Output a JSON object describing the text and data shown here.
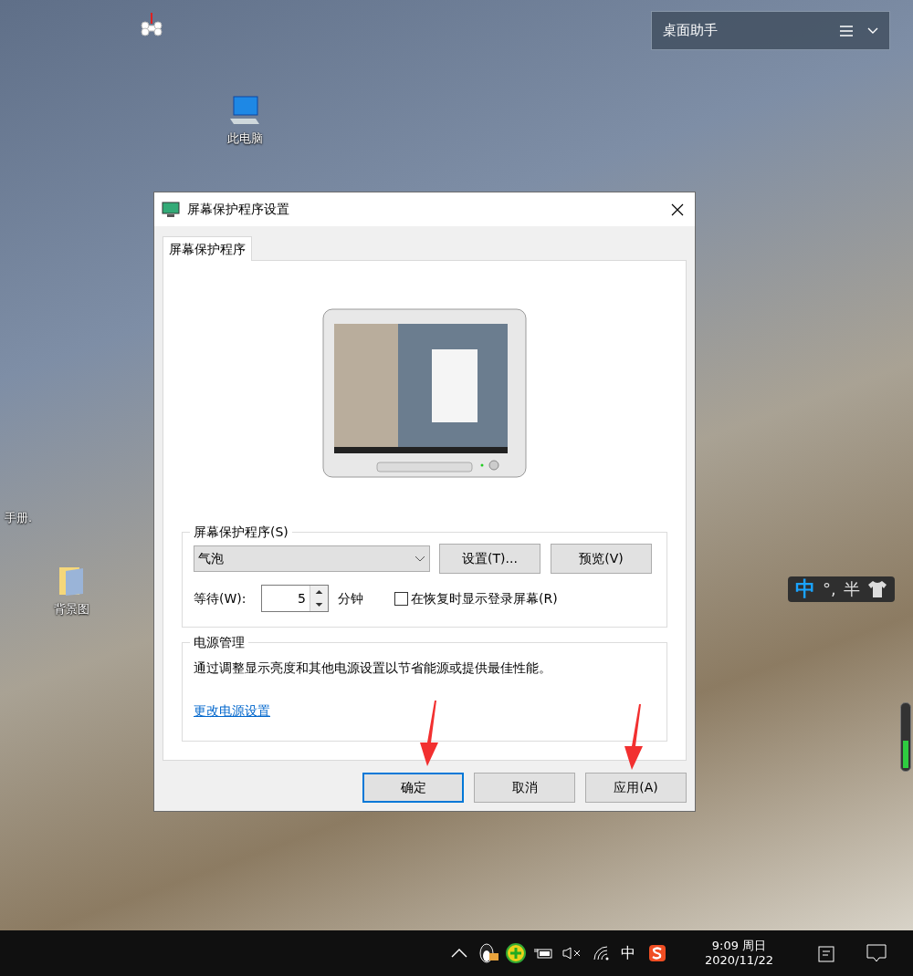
{
  "desktop": {
    "widget": {
      "title": "桌面助手"
    },
    "icons": [
      {
        "label": "此电脑",
        "kind": "computer"
      },
      {
        "label": "手册.",
        "kind": "partial"
      },
      {
        "label": "背景图",
        "kind": "folder"
      }
    ]
  },
  "dialog": {
    "title": "屏幕保护程序设置",
    "tabs": [
      {
        "label": "屏幕保护程序",
        "selected": true
      }
    ],
    "screensaver_group": {
      "legend": "屏幕保护程序(S)",
      "dropdown_value": "气泡",
      "settings_button": "设置(T)...",
      "preview_button": "预览(V)",
      "wait_label": "等待(W):",
      "wait_value": "5",
      "unit": "分钟",
      "resume_checkbox": {
        "label": "在恢复时显示登录屏幕(R)",
        "checked": false
      }
    },
    "power_group": {
      "legend": "电源管理",
      "description": "通过调整显示亮度和其他电源设置以节省能源或提供最佳性能。",
      "link": "更改电源设置"
    },
    "buttons": [
      {
        "label": "确定",
        "kind": "default"
      },
      {
        "label": "取消",
        "kind": "normal"
      },
      {
        "label": "应用(A)",
        "kind": "normal"
      }
    ]
  },
  "ime_toolbar": {
    "items": [
      "中",
      "°,",
      "半"
    ]
  },
  "taskbar": {
    "input_indicator": "中",
    "time": "9:09 周日",
    "date": "2020/11/22"
  }
}
